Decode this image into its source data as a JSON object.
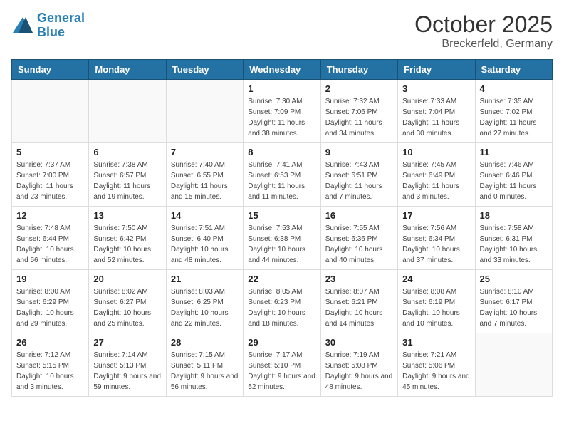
{
  "header": {
    "logo_line1": "General",
    "logo_line2": "Blue",
    "month": "October 2025",
    "location": "Breckerfeld, Germany"
  },
  "weekdays": [
    "Sunday",
    "Monday",
    "Tuesday",
    "Wednesday",
    "Thursday",
    "Friday",
    "Saturday"
  ],
  "weeks": [
    [
      {
        "day": "",
        "info": ""
      },
      {
        "day": "",
        "info": ""
      },
      {
        "day": "",
        "info": ""
      },
      {
        "day": "1",
        "info": "Sunrise: 7:30 AM\nSunset: 7:09 PM\nDaylight: 11 hours\nand 38 minutes."
      },
      {
        "day": "2",
        "info": "Sunrise: 7:32 AM\nSunset: 7:06 PM\nDaylight: 11 hours\nand 34 minutes."
      },
      {
        "day": "3",
        "info": "Sunrise: 7:33 AM\nSunset: 7:04 PM\nDaylight: 11 hours\nand 30 minutes."
      },
      {
        "day": "4",
        "info": "Sunrise: 7:35 AM\nSunset: 7:02 PM\nDaylight: 11 hours\nand 27 minutes."
      }
    ],
    [
      {
        "day": "5",
        "info": "Sunrise: 7:37 AM\nSunset: 7:00 PM\nDaylight: 11 hours\nand 23 minutes."
      },
      {
        "day": "6",
        "info": "Sunrise: 7:38 AM\nSunset: 6:57 PM\nDaylight: 11 hours\nand 19 minutes."
      },
      {
        "day": "7",
        "info": "Sunrise: 7:40 AM\nSunset: 6:55 PM\nDaylight: 11 hours\nand 15 minutes."
      },
      {
        "day": "8",
        "info": "Sunrise: 7:41 AM\nSunset: 6:53 PM\nDaylight: 11 hours\nand 11 minutes."
      },
      {
        "day": "9",
        "info": "Sunrise: 7:43 AM\nSunset: 6:51 PM\nDaylight: 11 hours\nand 7 minutes."
      },
      {
        "day": "10",
        "info": "Sunrise: 7:45 AM\nSunset: 6:49 PM\nDaylight: 11 hours\nand 3 minutes."
      },
      {
        "day": "11",
        "info": "Sunrise: 7:46 AM\nSunset: 6:46 PM\nDaylight: 11 hours\nand 0 minutes."
      }
    ],
    [
      {
        "day": "12",
        "info": "Sunrise: 7:48 AM\nSunset: 6:44 PM\nDaylight: 10 hours\nand 56 minutes."
      },
      {
        "day": "13",
        "info": "Sunrise: 7:50 AM\nSunset: 6:42 PM\nDaylight: 10 hours\nand 52 minutes."
      },
      {
        "day": "14",
        "info": "Sunrise: 7:51 AM\nSunset: 6:40 PM\nDaylight: 10 hours\nand 48 minutes."
      },
      {
        "day": "15",
        "info": "Sunrise: 7:53 AM\nSunset: 6:38 PM\nDaylight: 10 hours\nand 44 minutes."
      },
      {
        "day": "16",
        "info": "Sunrise: 7:55 AM\nSunset: 6:36 PM\nDaylight: 10 hours\nand 40 minutes."
      },
      {
        "day": "17",
        "info": "Sunrise: 7:56 AM\nSunset: 6:34 PM\nDaylight: 10 hours\nand 37 minutes."
      },
      {
        "day": "18",
        "info": "Sunrise: 7:58 AM\nSunset: 6:31 PM\nDaylight: 10 hours\nand 33 minutes."
      }
    ],
    [
      {
        "day": "19",
        "info": "Sunrise: 8:00 AM\nSunset: 6:29 PM\nDaylight: 10 hours\nand 29 minutes."
      },
      {
        "day": "20",
        "info": "Sunrise: 8:02 AM\nSunset: 6:27 PM\nDaylight: 10 hours\nand 25 minutes."
      },
      {
        "day": "21",
        "info": "Sunrise: 8:03 AM\nSunset: 6:25 PM\nDaylight: 10 hours\nand 22 minutes."
      },
      {
        "day": "22",
        "info": "Sunrise: 8:05 AM\nSunset: 6:23 PM\nDaylight: 10 hours\nand 18 minutes."
      },
      {
        "day": "23",
        "info": "Sunrise: 8:07 AM\nSunset: 6:21 PM\nDaylight: 10 hours\nand 14 minutes."
      },
      {
        "day": "24",
        "info": "Sunrise: 8:08 AM\nSunset: 6:19 PM\nDaylight: 10 hours\nand 10 minutes."
      },
      {
        "day": "25",
        "info": "Sunrise: 8:10 AM\nSunset: 6:17 PM\nDaylight: 10 hours\nand 7 minutes."
      }
    ],
    [
      {
        "day": "26",
        "info": "Sunrise: 7:12 AM\nSunset: 5:15 PM\nDaylight: 10 hours\nand 3 minutes."
      },
      {
        "day": "27",
        "info": "Sunrise: 7:14 AM\nSunset: 5:13 PM\nDaylight: 9 hours\nand 59 minutes."
      },
      {
        "day": "28",
        "info": "Sunrise: 7:15 AM\nSunset: 5:11 PM\nDaylight: 9 hours\nand 56 minutes."
      },
      {
        "day": "29",
        "info": "Sunrise: 7:17 AM\nSunset: 5:10 PM\nDaylight: 9 hours\nand 52 minutes."
      },
      {
        "day": "30",
        "info": "Sunrise: 7:19 AM\nSunset: 5:08 PM\nDaylight: 9 hours\nand 48 minutes."
      },
      {
        "day": "31",
        "info": "Sunrise: 7:21 AM\nSunset: 5:06 PM\nDaylight: 9 hours\nand 45 minutes."
      },
      {
        "day": "",
        "info": ""
      }
    ]
  ]
}
